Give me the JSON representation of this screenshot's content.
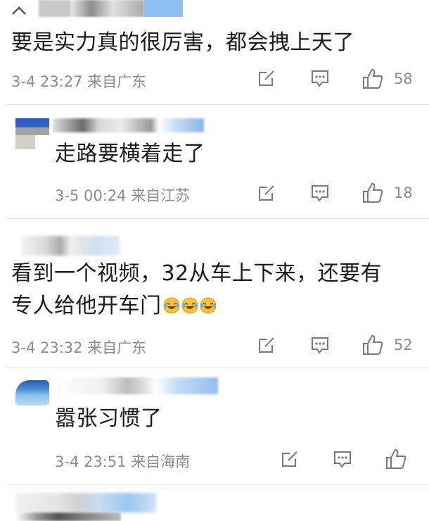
{
  "comments": [
    {
      "text": "要是实力真的很厉害，都会拽上天了",
      "date": "3-4 23:27",
      "location": "来自广东",
      "likes": "58"
    },
    {
      "text": "走路要横着走了",
      "date": "3-5 00:24",
      "location": "来自江苏",
      "likes": "18"
    },
    {
      "text_line1": "看到一个视频，32从车上下来，还要有",
      "text_line2": "专人给他开车门",
      "date": "3-4 23:32",
      "location": "来自广东",
      "likes": "52",
      "emoji": "laughing-crying-emoji"
    },
    {
      "text": "嚣张习惯了",
      "date": "3-4 23:51",
      "location": "来自海南",
      "likes": ""
    }
  ],
  "icons": {
    "edit": "edit-icon",
    "reply": "comment-icon",
    "like": "thumbs-up-icon"
  },
  "colors": {
    "text": "#1b1b1b",
    "meta": "#8c8c8c",
    "icon": "#7a7a7a",
    "blur_blue": "#8fc0ee"
  }
}
